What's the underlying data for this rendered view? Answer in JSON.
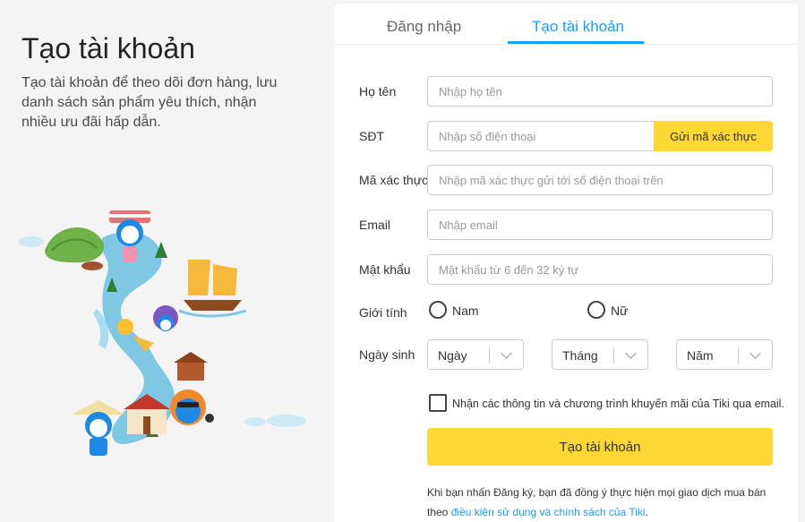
{
  "left": {
    "title": "Tạo tài khoản",
    "description": "Tạo tài khoản để theo dõi đơn hàng, lưu danh sách sản phẩm yêu thích, nhận nhiều ưu đãi hấp dẫn."
  },
  "tabs": {
    "login": "Đăng nhập",
    "register": "Tạo tài khoản"
  },
  "form": {
    "name_label": "Họ tên",
    "name_placeholder": "Nhập họ tên",
    "phone_label": "SĐT",
    "phone_placeholder": "Nhập số điện thoại",
    "send_code_label": "Gửi mã xác thực",
    "code_label": "Mã xác thực",
    "code_placeholder": "Nhập mã xác thực gửi tới số điện thoại trên",
    "email_label": "Email",
    "email_placeholder": "Nhập email",
    "password_label": "Mật khẩu",
    "password_placeholder": "Mật khẩu từ 6 đến 32 ký tự",
    "gender_label": "Giới tính",
    "gender_male": "Nam",
    "gender_female": "Nữ",
    "dob_label": "Ngày sinh",
    "dob_day": "Ngày",
    "dob_month": "Tháng",
    "dob_year": "Năm",
    "promo_checkbox_label": "Nhận các thông tin và chương trình khuyến mãi của Tiki qua email.",
    "submit_label": "Tạo tài khoản",
    "terms_text": "Khi bạn nhấn Đăng ký, bạn đã đồng ý thực hiện mọi giao dịch mua bán theo",
    "terms_link": "điều kiện sử dụng và chính sách của Tiki",
    "terms_end": "."
  },
  "colors": {
    "accent_blue": "#189eff",
    "accent_yellow": "#fdd835"
  },
  "illustration": "vietnam-map-illustration"
}
